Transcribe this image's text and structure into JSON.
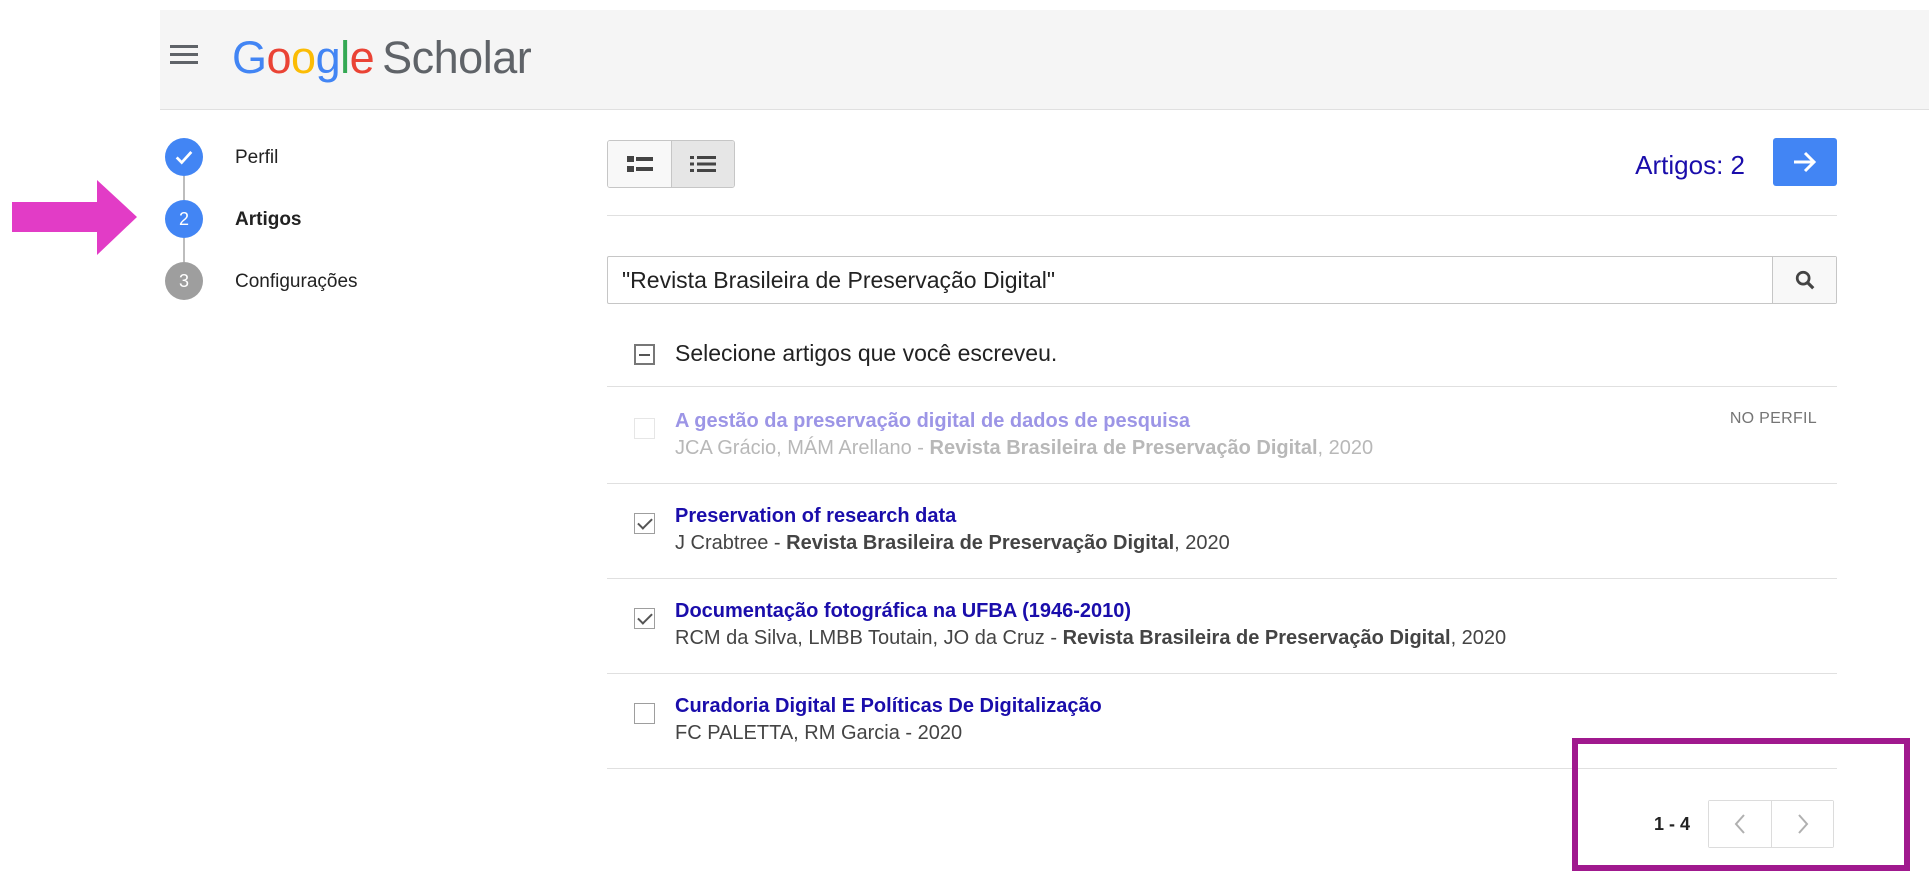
{
  "header": {
    "menu_icon": "hamburger-menu-icon",
    "logo": {
      "google": [
        "G",
        "o",
        "o",
        "g",
        "l",
        "e"
      ],
      "product": "Scholar"
    }
  },
  "steps": [
    {
      "marker": "",
      "label": "Perfil",
      "state": "done"
    },
    {
      "marker": "2",
      "label": "Artigos",
      "state": "active"
    },
    {
      "marker": "3",
      "label": "Configurações",
      "state": "todo"
    }
  ],
  "toolbar": {
    "view_buttons": [
      "list-view-icon",
      "compact-list-view-icon"
    ],
    "artigos_count": "Artigos: 2",
    "next_icon": "arrow-right-icon"
  },
  "search": {
    "value": "\"Revista Brasileira de Preservação Digital\"",
    "icon": "search-icon"
  },
  "select_all_text": "Selecione artigos que você escreveu.",
  "results": [
    {
      "title": "A gestão da preservação digital de dados de pesquisa",
      "authors": "JCA Grácio, MÁM Arellano - ",
      "journal": "Revista Brasileira de Preservação Digital",
      "year": ", 2020",
      "badge": "NO PERFIL",
      "checked": false,
      "disabled": true
    },
    {
      "title": "Preservation of research data",
      "authors": "J Crabtree - ",
      "journal": "Revista Brasileira de Preservação Digital",
      "year": ", 2020",
      "badge": "",
      "checked": true,
      "disabled": false
    },
    {
      "title": "Documentação fotográfica na UFBA (1946-2010)",
      "authors": "RCM da Silva, LMBB Toutain, JO da Cruz - ",
      "journal": "Revista Brasileira de Preservação Digital",
      "year": ", 2020",
      "badge": "",
      "checked": true,
      "disabled": false
    },
    {
      "title": "Curadoria Digital E Políticas De Digitalização",
      "authors": "FC PALETTA, RM Garcia - 2020",
      "journal": "",
      "year": "",
      "badge": "",
      "checked": false,
      "disabled": false
    }
  ],
  "pagination": {
    "range": "1 - 4"
  },
  "colors": {
    "accent": "#4285f4",
    "link": "#1a0dab",
    "annotation_arrow": "#e23cc6",
    "annotation_box": "#a0198e"
  }
}
